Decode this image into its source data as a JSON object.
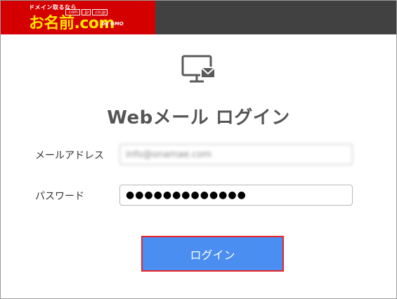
{
  "header": {
    "logo": {
      "tagline": "ドメイン取るなら",
      "tlds": [
        ".com",
        ".jp",
        ".co.jp"
      ],
      "brand": "お名前.com",
      "by": "by GMO",
      "bg_color": "#d40000",
      "brand_color": "#ffe400"
    },
    "bar_color": "#414141"
  },
  "page": {
    "icon": "monitor-checkmark-icon",
    "title": "Webメール ログイン"
  },
  "form": {
    "email_label": "メールアドレス",
    "email_value": "info@onamae.com",
    "password_label": "パスワード",
    "password_value": "●●●●●●●●●●●●●",
    "submit_label": "ログイン",
    "submit_color": "#4a8ef2",
    "submit_border_color": "#e8242a"
  }
}
